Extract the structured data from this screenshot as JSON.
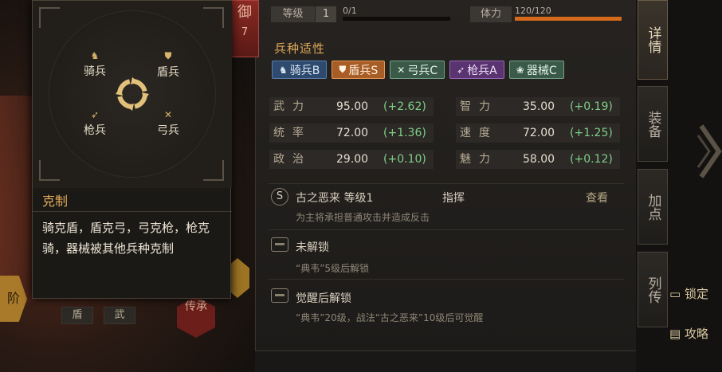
{
  "header": {
    "level_label": "等级",
    "level_value": "1",
    "exp_text": "0/1",
    "exp_progress": 0,
    "stamina_label": "体力",
    "stamina_text": "120/120",
    "stamina_progress": 1.0
  },
  "badge": {
    "char": "御",
    "num": "7"
  },
  "aptitude": {
    "title": "兵种适性",
    "items": [
      {
        "label": "骑兵B",
        "icon": "horse-icon"
      },
      {
        "label": "盾兵S",
        "icon": "shield-icon"
      },
      {
        "label": "弓兵C",
        "icon": "bow-icon"
      },
      {
        "label": "枪兵A",
        "icon": "spear-icon"
      },
      {
        "label": "器械C",
        "icon": "gear-icon"
      }
    ]
  },
  "stats": [
    {
      "name": "武力",
      "value": "95.00",
      "bonus": "(+2.62)"
    },
    {
      "name": "智力",
      "value": "35.00",
      "bonus": "(+0.19)"
    },
    {
      "name": "统率",
      "value": "72.00",
      "bonus": "(+1.36)"
    },
    {
      "name": "速度",
      "value": "72.00",
      "bonus": "(+1.25)"
    },
    {
      "name": "政治",
      "value": "29.00",
      "bonus": "(+0.10)"
    },
    {
      "name": "魅力",
      "value": "58.00",
      "bonus": "(+0.12)"
    }
  ],
  "skills": [
    {
      "icon_text": "S",
      "name": "古之恶来 等级1",
      "type": "指挥",
      "view": "查看",
      "desc": "为主将承担普通攻击并造成反击"
    },
    {
      "name": "未解锁",
      "desc": "“典韦”5级后解锁"
    },
    {
      "name": "觉醒后解锁",
      "desc": "“典韦”20级，战法“古之恶来”10级后可觉醒"
    }
  ],
  "side_tabs": [
    "详情",
    "装备",
    "加点",
    "列传"
  ],
  "side_strips": {
    "lock": "锁定",
    "strategy": "攻略"
  },
  "counter_panel": {
    "labels": {
      "cavalry": "骑兵",
      "shield": "盾兵",
      "spear": "枪兵",
      "bow": "弓兵"
    },
    "heading": "克制",
    "text": "骑克盾，盾克弓，弓克枪，枪克骑，器械被其他兵种克制"
  },
  "bottom_left": {
    "rank": "阶",
    "tag1": "盾",
    "tag2": "武",
    "chuan": "传承"
  },
  "colors": {
    "accent": "#e0a95a",
    "bonus_green": "#7fcf88",
    "stamina": "#d46a1a"
  }
}
